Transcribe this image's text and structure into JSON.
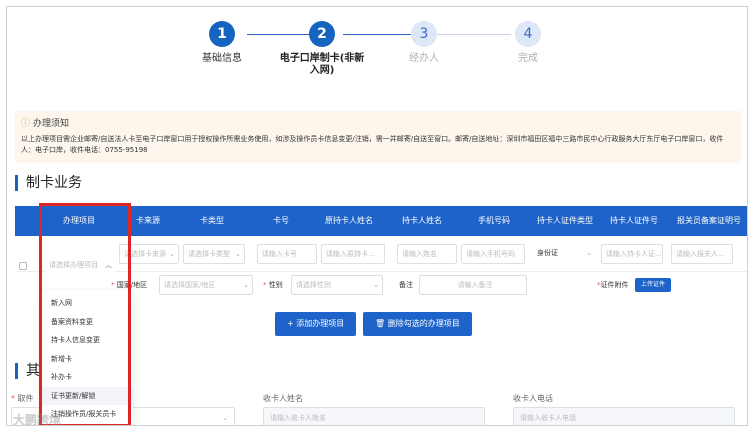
{
  "steps": [
    {
      "number": "1",
      "label": "基础信息"
    },
    {
      "number": "2",
      "label": "电子口岸制卡(非新入网)"
    },
    {
      "number": "3",
      "label": "经办人"
    },
    {
      "number": "4",
      "label": "完成"
    }
  ],
  "notice": {
    "title": "办理须知",
    "text": "以上办理项目需企业邮寄/自送法人卡至电子口岸窗口用于授权操作所需业务使用，如涉及操作员卡信息变更/注销，需一并邮寄/自送至窗口。邮寄/自送地址：深圳市福田区福中三路市民中心行政服务大厅东厅电子口岸窗口，收件人：电子口岸，收件电话：0755-95198"
  },
  "section": {
    "title": "制卡业务"
  },
  "table": {
    "headers": [
      "办理项目",
      "卡来源",
      "卡类型",
      "卡号",
      "原持卡人姓名",
      "持卡人姓名",
      "手机号码",
      "持卡人证件类型",
      "持卡人证件号",
      "报关员备案证明号"
    ],
    "row": {
      "project_placeholder": "请选择办理项目",
      "card_source_placeholder": "请选择卡来源",
      "card_type_placeholder": "请选择卡类型",
      "card_no_placeholder": "请输入卡号",
      "orig_holder_placeholder": "请输入原持卡...",
      "holder_name_placeholder": "请输入姓名",
      "phone_placeholder": "请输入手机号码",
      "id_type_value": "身份证",
      "id_no_placeholder": "请输入持卡人证...",
      "broker_placeholder": "请输入报关人..."
    },
    "row2": {
      "country_label": "国家/地区",
      "country_placeholder": "请选择国家/地区",
      "gender_label": "性别",
      "gender_placeholder": "请选择性别",
      "remark_label": "备注",
      "remark_placeholder": "请输入备注",
      "attach_label": "证件附件",
      "upload_label": "上传证件"
    }
  },
  "actions": {
    "add_label": "+ 添加办理项目",
    "delete_label": "删除勾选的办理项目"
  },
  "dropdown": {
    "options": [
      "新入网",
      "备案资料变更",
      "持卡人信息变更",
      "新增卡",
      "补办卡",
      "证书更新/解锁",
      "注销操作员/报关员卡"
    ],
    "highlighted": 5
  },
  "bottom": {
    "section_title": "其",
    "fields": [
      {
        "label": "取件",
        "placeholder": ""
      },
      {
        "label": "收卡人姓名",
        "placeholder": "请输入收卡人姓名"
      },
      {
        "label": "收卡人电话",
        "placeholder": "请输入收卡人电话"
      }
    ]
  },
  "watermark": "大鹏跨境",
  "colors": {
    "primary": "#1e63c9",
    "highlight_box": "#e02525",
    "notice_bg": "#fdf6ec",
    "warning": "#e6a23c"
  }
}
